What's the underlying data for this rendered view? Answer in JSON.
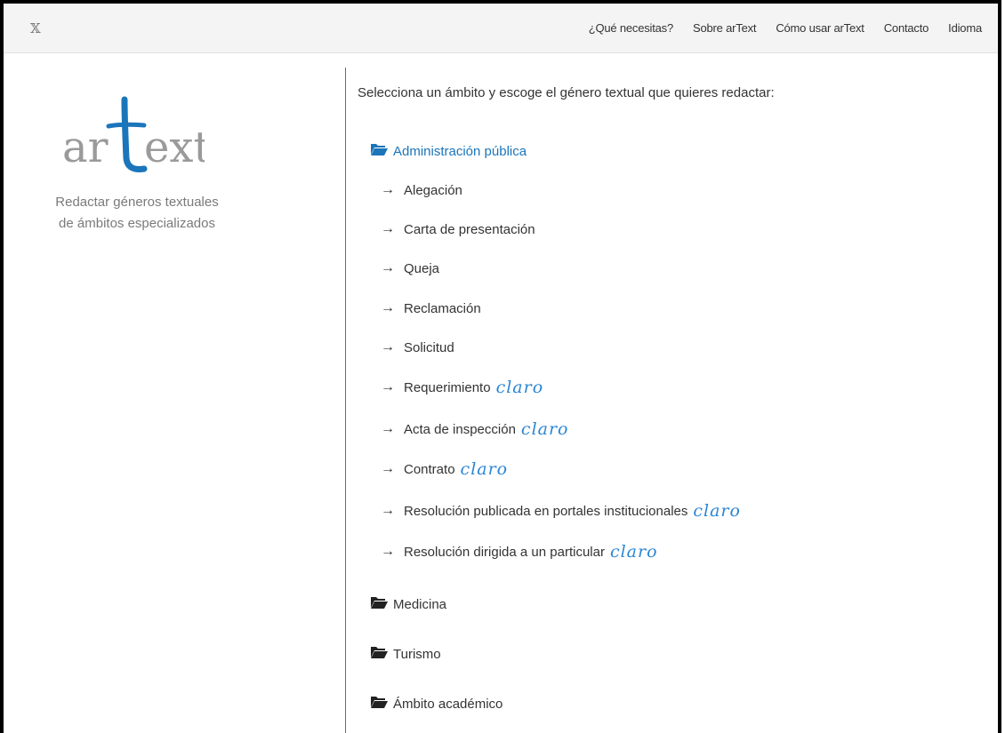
{
  "topbar": {
    "close_glyph": "𝕏",
    "nav": [
      "¿Qué necesitas?",
      "Sobre arText",
      "Cómo usar arText",
      "Contacto",
      "Idioma"
    ]
  },
  "sidebar": {
    "logo_text": "artext",
    "tagline_line1": "Redactar géneros textuales",
    "tagline_line2": "de ámbitos especializados",
    "logo_color": "#1b75bb"
  },
  "main": {
    "intro": "Selecciona un ámbito y escoge el género textual que quieres redactar:",
    "categories": [
      {
        "label": "Administración pública",
        "active": true,
        "items": [
          {
            "label": "Alegación",
            "tag": ""
          },
          {
            "label": "Carta de presentación",
            "tag": ""
          },
          {
            "label": "Queja",
            "tag": ""
          },
          {
            "label": "Reclamación",
            "tag": ""
          },
          {
            "label": "Solicitud",
            "tag": ""
          },
          {
            "label": "Requerimiento",
            "tag": "claro"
          },
          {
            "label": "Acta de inspección",
            "tag": "claro"
          },
          {
            "label": "Contrato",
            "tag": "claro"
          },
          {
            "label": "Resolución publicada en portales institucionales",
            "tag": "claro"
          },
          {
            "label": "Resolución dirigida a un particular",
            "tag": "claro"
          }
        ]
      },
      {
        "label": "Medicina",
        "active": false
      },
      {
        "label": "Turismo",
        "active": false
      },
      {
        "label": "Ámbito académico",
        "active": false
      }
    ]
  },
  "colors": {
    "accent": "#1b75bb",
    "claro": "#2a86d6"
  }
}
